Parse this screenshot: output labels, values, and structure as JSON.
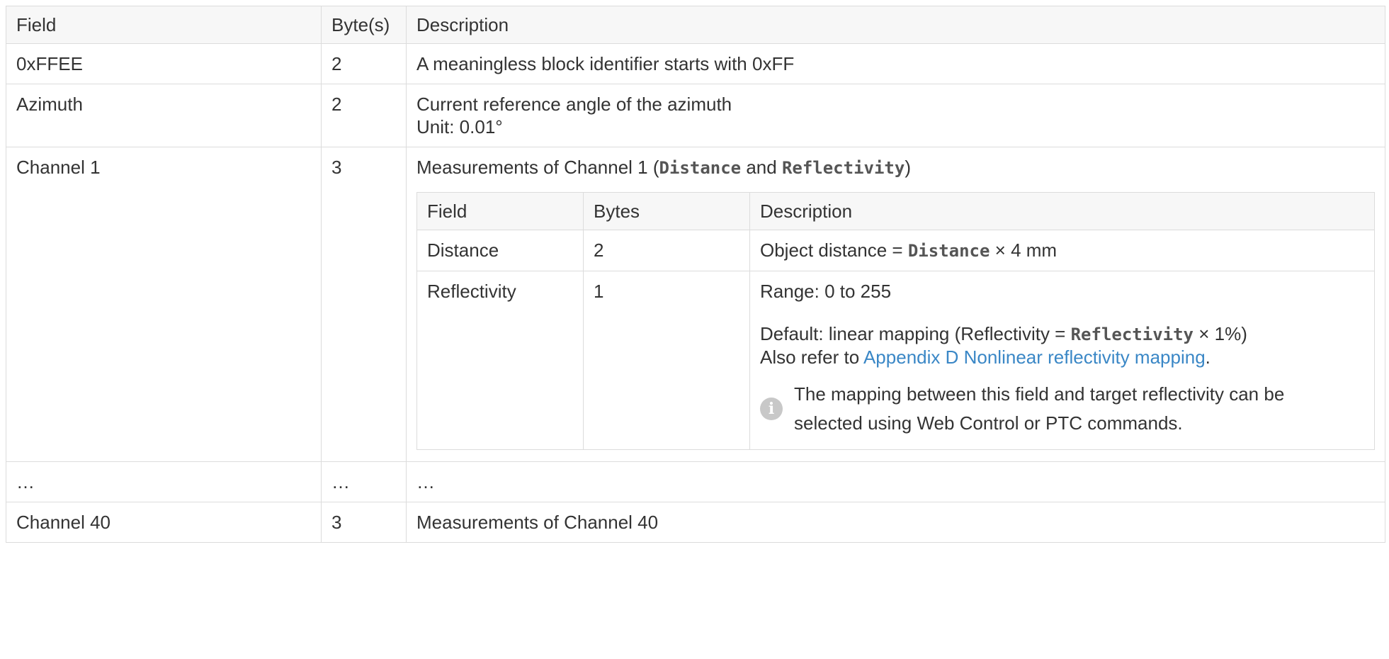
{
  "outer": {
    "headers": [
      "Field",
      "Byte(s)",
      "Description"
    ],
    "row_identifier": {
      "field": "0xFFEE",
      "bytes": "2",
      "description": "A meaningless block identifier starts with 0xFF"
    },
    "row_azimuth": {
      "field": "Azimuth",
      "bytes": "2",
      "description_line1": "Current reference angle of the azimuth",
      "description_line2": "Unit: 0.01°"
    },
    "row_channel1": {
      "field": "Channel 1",
      "bytes": "3",
      "desc_prefix": "Measurements of Channel 1 (",
      "desc_distance": "Distance",
      "desc_and": " and ",
      "desc_reflectivity": "Reflectivity",
      "desc_suffix": ")"
    },
    "row_ellipsis": {
      "field": "…",
      "bytes": "…",
      "description": "…"
    },
    "row_channel40": {
      "field": "Channel 40",
      "bytes": "3",
      "description": "Measurements of Channel 40"
    }
  },
  "inner": {
    "headers": [
      "Field",
      "Bytes",
      "Description"
    ],
    "row_distance": {
      "field": "Distance",
      "bytes": "2",
      "desc_prefix": "Object distance = ",
      "desc_code": "Distance",
      "desc_suffix": " × 4 mm"
    },
    "row_reflectivity": {
      "field": "Reflectivity",
      "bytes": "1",
      "range": "Range: 0 to 255",
      "default_prefix": "Default: linear mapping (Reflectivity = ",
      "default_code": "Reflectivity",
      "default_suffix": " × 1%)",
      "refer_prefix": "Also refer to ",
      "refer_link": "Appendix D Nonlinear reflectivity mapping",
      "refer_suffix": ".",
      "note_icon": "info-icon",
      "note_glyph": "i",
      "note": "The mapping between this field and target reflectivity can be selected using Web Control or PTC commands."
    }
  }
}
